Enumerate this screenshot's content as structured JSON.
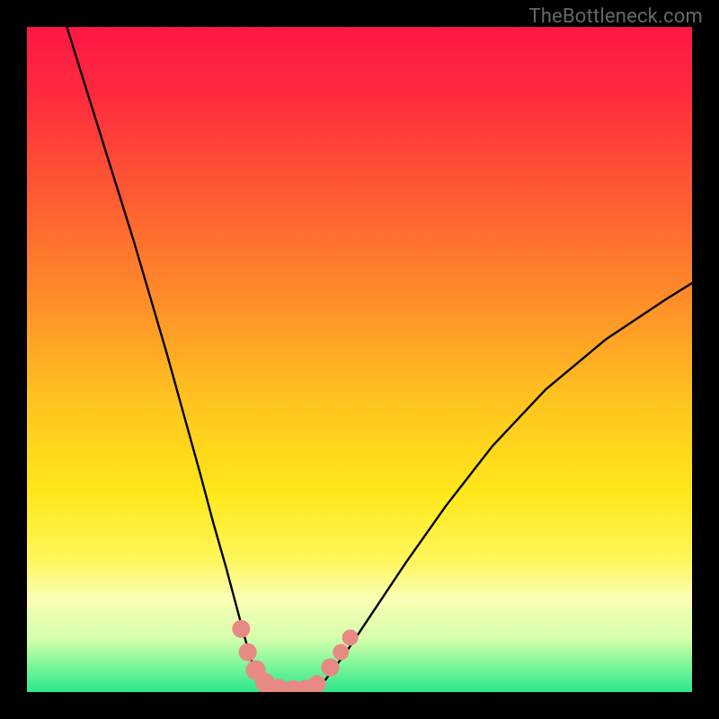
{
  "watermark": "TheBottleneck.com",
  "chart_data": {
    "type": "line",
    "title": "",
    "xlabel": "",
    "ylabel": "",
    "xlim": [
      0,
      1
    ],
    "ylim": [
      0,
      1
    ],
    "gradient_stops": [
      {
        "offset": 0.0,
        "color": "#ff1846"
      },
      {
        "offset": 0.1,
        "color": "#ff2a3e"
      },
      {
        "offset": 0.25,
        "color": "#ff5a33"
      },
      {
        "offset": 0.4,
        "color": "#ff8a2a"
      },
      {
        "offset": 0.55,
        "color": "#ffc020"
      },
      {
        "offset": 0.7,
        "color": "#ffe81a"
      },
      {
        "offset": 0.8,
        "color": "#fff65a"
      },
      {
        "offset": 0.86,
        "color": "#fbffb6"
      },
      {
        "offset": 0.92,
        "color": "#d4ffab"
      },
      {
        "offset": 0.96,
        "color": "#7df59a"
      },
      {
        "offset": 1.0,
        "color": "#2be88e"
      }
    ],
    "series": [
      {
        "name": "left-branch",
        "x": [
          0.06,
          0.085,
          0.11,
          0.135,
          0.16,
          0.185,
          0.21,
          0.235,
          0.26,
          0.28,
          0.3,
          0.316,
          0.328,
          0.34,
          0.348,
          0.353
        ],
        "y": [
          1.0,
          0.92,
          0.84,
          0.76,
          0.68,
          0.595,
          0.51,
          0.42,
          0.33,
          0.255,
          0.185,
          0.125,
          0.08,
          0.04,
          0.015,
          0.0
        ]
      },
      {
        "name": "floor-segment",
        "x": [
          0.353,
          0.38,
          0.408,
          0.432
        ],
        "y": [
          0.0,
          0.0,
          0.0,
          0.0
        ]
      },
      {
        "name": "right-branch",
        "x": [
          0.432,
          0.45,
          0.48,
          0.52,
          0.57,
          0.63,
          0.7,
          0.78,
          0.87,
          0.96,
          1.0
        ],
        "y": [
          0.0,
          0.02,
          0.06,
          0.12,
          0.195,
          0.28,
          0.37,
          0.455,
          0.53,
          0.59,
          0.615
        ]
      }
    ],
    "markers": [
      {
        "x": 0.322,
        "y": 0.095,
        "r": 10
      },
      {
        "x": 0.332,
        "y": 0.06,
        "r": 10
      },
      {
        "x": 0.344,
        "y": 0.033,
        "r": 11
      },
      {
        "x": 0.358,
        "y": 0.014,
        "r": 11
      },
      {
        "x": 0.378,
        "y": 0.005,
        "r": 11
      },
      {
        "x": 0.4,
        "y": 0.003,
        "r": 11
      },
      {
        "x": 0.42,
        "y": 0.004,
        "r": 11
      },
      {
        "x": 0.436,
        "y": 0.012,
        "r": 10
      },
      {
        "x": 0.456,
        "y": 0.037,
        "r": 10
      },
      {
        "x": 0.472,
        "y": 0.06,
        "r": 9
      },
      {
        "x": 0.486,
        "y": 0.082,
        "r": 9
      }
    ],
    "marker_color": "#e88a84"
  }
}
